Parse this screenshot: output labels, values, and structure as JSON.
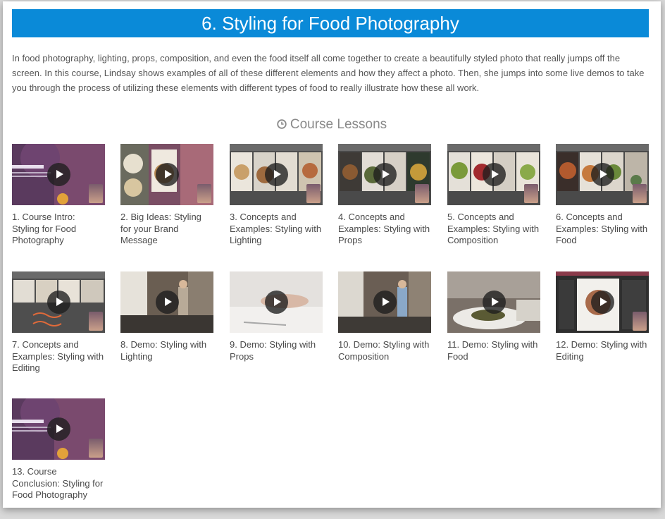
{
  "header": {
    "title": "6. Styling for Food Photography"
  },
  "description": "In food photography, lighting, props, composition, and even the food itself all come together to create a beautifully styled photo that really jumps off the screen. In this course, Lindsay shows examples of all of these different elements and how they affect a photo. Then, she jumps into some live demos to take you through the process of utilizing these elements with different types of food to really illustrate how these all work.",
  "lessons_section": {
    "heading": "Course Lessons",
    "icon": "clock-icon"
  },
  "lessons": [
    {
      "label": "1. Course Intro: Styling for Food Photography"
    },
    {
      "label": "2. Big Ideas: Styling for your Brand Message"
    },
    {
      "label": "3. Concepts and Examples: Styling with Lighting"
    },
    {
      "label": "4. Concepts and Examples: Styling with Props"
    },
    {
      "label": "5. Concepts and Examples: Styling with Composition"
    },
    {
      "label": "6. Concepts and Examples: Styling with Food"
    },
    {
      "label": "7. Concepts and Examples: Styling with Editing"
    },
    {
      "label": "8. Demo: Styling with Lighting"
    },
    {
      "label": "9. Demo: Styling with Props"
    },
    {
      "label": "10. Demo: Styling with Composition"
    },
    {
      "label": "11. Demo: Styling with Food"
    },
    {
      "label": "12. Demo: Styling with Editing"
    },
    {
      "label": "13. Course Conclusion: Styling for Food Photography"
    }
  ],
  "colors": {
    "title_bar": "#0a8ad8",
    "text": "#555555",
    "heading": "#8a8a8a"
  }
}
